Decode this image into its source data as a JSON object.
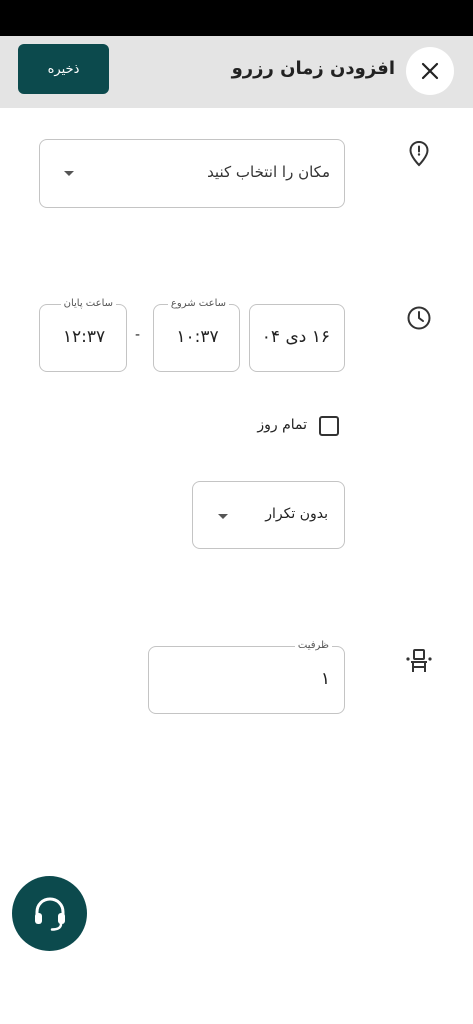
{
  "header": {
    "title": "افزودن زمان رزرو",
    "save_label": "ذخیره",
    "close_icon": "close-icon"
  },
  "location": {
    "icon": "location-pin-icon",
    "placeholder": "مکان را انتخاب کنید"
  },
  "time": {
    "icon": "clock-icon",
    "date_value": "۱۶ دی ۰۴",
    "start_label": "ساعت شروع",
    "start_value": "۱۰:۳۷",
    "separator": "-",
    "end_label": "ساعت پایان",
    "end_value": "۱۲:۳۷"
  },
  "all_day": {
    "label": "تمام روز",
    "checked": false
  },
  "repeat": {
    "value": "بدون تکرار"
  },
  "capacity": {
    "icon": "seat-icon",
    "label": "ظرفیت",
    "value": "۱"
  },
  "support": {
    "icon": "headset-icon"
  },
  "colors": {
    "primary": "#0c4a4d",
    "header_bg": "#e4e4e4",
    "border": "#c4c4c4"
  }
}
